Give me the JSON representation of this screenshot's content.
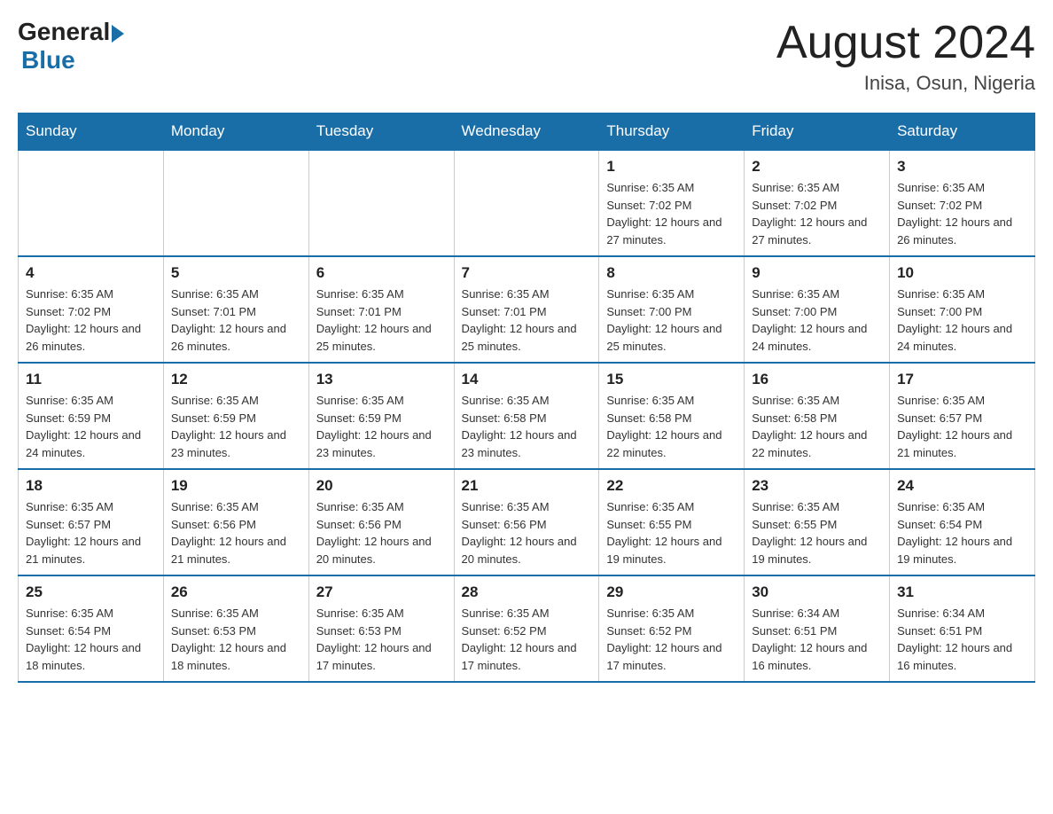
{
  "header": {
    "logo_general": "General",
    "logo_blue": "Blue",
    "month": "August 2024",
    "location": "Inisa, Osun, Nigeria"
  },
  "weekdays": [
    "Sunday",
    "Monday",
    "Tuesday",
    "Wednesday",
    "Thursday",
    "Friday",
    "Saturday"
  ],
  "weeks": [
    [
      {
        "day": "",
        "info": ""
      },
      {
        "day": "",
        "info": ""
      },
      {
        "day": "",
        "info": ""
      },
      {
        "day": "",
        "info": ""
      },
      {
        "day": "1",
        "info": "Sunrise: 6:35 AM\nSunset: 7:02 PM\nDaylight: 12 hours and 27 minutes."
      },
      {
        "day": "2",
        "info": "Sunrise: 6:35 AM\nSunset: 7:02 PM\nDaylight: 12 hours and 27 minutes."
      },
      {
        "day": "3",
        "info": "Sunrise: 6:35 AM\nSunset: 7:02 PM\nDaylight: 12 hours and 26 minutes."
      }
    ],
    [
      {
        "day": "4",
        "info": "Sunrise: 6:35 AM\nSunset: 7:02 PM\nDaylight: 12 hours and 26 minutes."
      },
      {
        "day": "5",
        "info": "Sunrise: 6:35 AM\nSunset: 7:01 PM\nDaylight: 12 hours and 26 minutes."
      },
      {
        "day": "6",
        "info": "Sunrise: 6:35 AM\nSunset: 7:01 PM\nDaylight: 12 hours and 25 minutes."
      },
      {
        "day": "7",
        "info": "Sunrise: 6:35 AM\nSunset: 7:01 PM\nDaylight: 12 hours and 25 minutes."
      },
      {
        "day": "8",
        "info": "Sunrise: 6:35 AM\nSunset: 7:00 PM\nDaylight: 12 hours and 25 minutes."
      },
      {
        "day": "9",
        "info": "Sunrise: 6:35 AM\nSunset: 7:00 PM\nDaylight: 12 hours and 24 minutes."
      },
      {
        "day": "10",
        "info": "Sunrise: 6:35 AM\nSunset: 7:00 PM\nDaylight: 12 hours and 24 minutes."
      }
    ],
    [
      {
        "day": "11",
        "info": "Sunrise: 6:35 AM\nSunset: 6:59 PM\nDaylight: 12 hours and 24 minutes."
      },
      {
        "day": "12",
        "info": "Sunrise: 6:35 AM\nSunset: 6:59 PM\nDaylight: 12 hours and 23 minutes."
      },
      {
        "day": "13",
        "info": "Sunrise: 6:35 AM\nSunset: 6:59 PM\nDaylight: 12 hours and 23 minutes."
      },
      {
        "day": "14",
        "info": "Sunrise: 6:35 AM\nSunset: 6:58 PM\nDaylight: 12 hours and 23 minutes."
      },
      {
        "day": "15",
        "info": "Sunrise: 6:35 AM\nSunset: 6:58 PM\nDaylight: 12 hours and 22 minutes."
      },
      {
        "day": "16",
        "info": "Sunrise: 6:35 AM\nSunset: 6:58 PM\nDaylight: 12 hours and 22 minutes."
      },
      {
        "day": "17",
        "info": "Sunrise: 6:35 AM\nSunset: 6:57 PM\nDaylight: 12 hours and 21 minutes."
      }
    ],
    [
      {
        "day": "18",
        "info": "Sunrise: 6:35 AM\nSunset: 6:57 PM\nDaylight: 12 hours and 21 minutes."
      },
      {
        "day": "19",
        "info": "Sunrise: 6:35 AM\nSunset: 6:56 PM\nDaylight: 12 hours and 21 minutes."
      },
      {
        "day": "20",
        "info": "Sunrise: 6:35 AM\nSunset: 6:56 PM\nDaylight: 12 hours and 20 minutes."
      },
      {
        "day": "21",
        "info": "Sunrise: 6:35 AM\nSunset: 6:56 PM\nDaylight: 12 hours and 20 minutes."
      },
      {
        "day": "22",
        "info": "Sunrise: 6:35 AM\nSunset: 6:55 PM\nDaylight: 12 hours and 19 minutes."
      },
      {
        "day": "23",
        "info": "Sunrise: 6:35 AM\nSunset: 6:55 PM\nDaylight: 12 hours and 19 minutes."
      },
      {
        "day": "24",
        "info": "Sunrise: 6:35 AM\nSunset: 6:54 PM\nDaylight: 12 hours and 19 minutes."
      }
    ],
    [
      {
        "day": "25",
        "info": "Sunrise: 6:35 AM\nSunset: 6:54 PM\nDaylight: 12 hours and 18 minutes."
      },
      {
        "day": "26",
        "info": "Sunrise: 6:35 AM\nSunset: 6:53 PM\nDaylight: 12 hours and 18 minutes."
      },
      {
        "day": "27",
        "info": "Sunrise: 6:35 AM\nSunset: 6:53 PM\nDaylight: 12 hours and 17 minutes."
      },
      {
        "day": "28",
        "info": "Sunrise: 6:35 AM\nSunset: 6:52 PM\nDaylight: 12 hours and 17 minutes."
      },
      {
        "day": "29",
        "info": "Sunrise: 6:35 AM\nSunset: 6:52 PM\nDaylight: 12 hours and 17 minutes."
      },
      {
        "day": "30",
        "info": "Sunrise: 6:34 AM\nSunset: 6:51 PM\nDaylight: 12 hours and 16 minutes."
      },
      {
        "day": "31",
        "info": "Sunrise: 6:34 AM\nSunset: 6:51 PM\nDaylight: 12 hours and 16 minutes."
      }
    ]
  ]
}
